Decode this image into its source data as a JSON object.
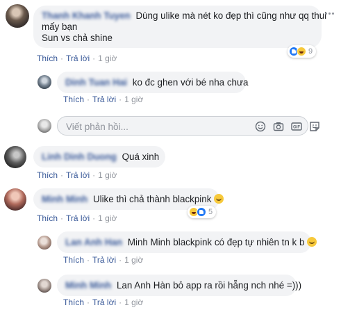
{
  "comments": [
    {
      "author": "Thanh Khanh Tuyen",
      "text_line1": "Dùng ulike mà nét ko đẹp thì cũng như qq thui",
      "text_line2": "mấy bạn",
      "text_line3": "Sun vs chả shine",
      "like_label": "Thích",
      "reply_label": "Trả lời",
      "time": "1 giờ",
      "reaction_count": "9"
    },
    {
      "author": "Dinh Tuan Hai",
      "text": "ko đc ghen với bé nha chưa",
      "like_label": "Thích",
      "reply_label": "Trả lời",
      "time": "1 giờ"
    },
    {
      "author": "Linh Dinh Duong",
      "text": "Quá xinh",
      "like_label": "Thích",
      "reply_label": "Trả lời",
      "time": "1 giờ"
    },
    {
      "author": "Minh Minh",
      "text": "Ulike thì chả thành blackpink",
      "like_label": "Thích",
      "reply_label": "Trả lời",
      "time": "1 giờ",
      "reaction_count": "5"
    },
    {
      "author": "Lan Anh Han",
      "text": "Minh Minh blackpink có đẹp tự nhiên tn k b",
      "like_label": "Thích",
      "reply_label": "Trả lời",
      "time": "1 giờ"
    },
    {
      "author": "Minh Minh",
      "text": "Lan Anh Hàn bỏ app ra rồi hẵng nch nhé =)))",
      "like_label": "Thích",
      "reply_label": "Trả lời",
      "time": "1 giờ"
    }
  ],
  "reply_box": {
    "placeholder": "Viết phản hồi..."
  },
  "icons": [
    "emoji-icon",
    "camera-icon",
    "gif-icon",
    "sticker-icon",
    "more-options-icon"
  ],
  "colors": {
    "link": "#385898",
    "bubble": "#f2f3f5",
    "meta": "#90949c",
    "like": "#2078f4",
    "haha": "#f7c93b"
  }
}
